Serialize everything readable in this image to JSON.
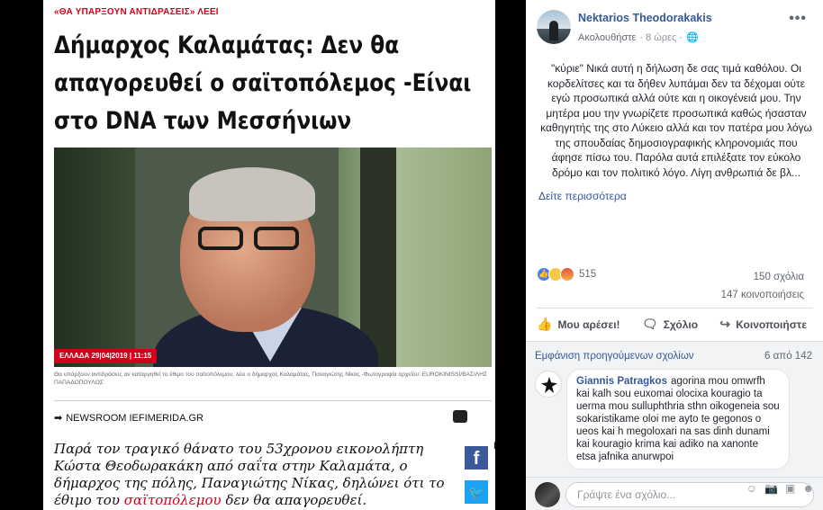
{
  "article": {
    "kicker": "«ΘΑ ΥΠΑΡΞΟΥΝ ΑΝΤΙΔΡΑΣΕΙΣ» ΛΕΕΙ",
    "headline_lines": [
      "Δήμαρχος Καλαμάτας: Δεν θα",
      "απαγορευθεί ο σαϊτοπόλεμος -Είναι",
      "στο DNA των Μεσσήνιων"
    ],
    "photo_tag_section": "ΕΛΛΑΔΑ 29|04|2019 | 11:15",
    "photo_tag_time": "",
    "caption": "Θα υπάρξουν αντιδράσεις αν καταργηθεί το έθιμο του σαϊτοπόλεμου, λέει ο δήμαρχος Καλαμάτας, Παναγιώτης Νίκας -Φωτογραφία αρχείου: EUROKINISSI/ΒΑΣΙΛΗΣ ΠΑΠΑΔΟΠΟΥΛΟΣ",
    "source": "NEWSROOM IEFIMERIDA.GR",
    "lede_before": "Παρά τον τραγικό θάνατο του 53χρονου εικονολήπτη Κώστα Θεοδωρακάκη από σαΐτα στην Καλαμάτα, ο δήμαρχος της πόλης, Παναγιώτης Νίκας, δηλώνει ότι το έθιμο του ",
    "lede_highlight": "σαϊτοπόλεμου",
    "lede_after": " δεν θα απαγορευθεί.",
    "share_fb": "f",
    "share_tw": "🐦"
  },
  "post": {
    "author": "Nektarios Theodorakakis",
    "follow_label": "Ακολουθήστε",
    "time": "· 8 ώρες ·",
    "privacy_icon": "globe-icon",
    "more": "•••",
    "text": "\"κύριε\" Νικά αυτή η δήλωση δε σας τιμά καθόλου. Οι κορδελίτσες και τα δήθεν λυπάμαι δεν τα δέχομαι ούτε εγώ προσωπικά αλλά ούτε και η οικογένειά μου. Την μητέρα μου την γνωρίζετε προσωπικά καθώς ήσασταν καθηγητής της στο Λύκειο αλλά και τον πατέρα μου λόγω της σπουδαίας δημοσιογραφικής κληρονομιάς που άφησε πίσω του. Παρόλα αυτά επιλέξατε τον εύκολο δρόμο και τον πολιτικό λόγο. Λίγη ανθρωπιά δε βλ...",
    "see_more": "Δείτε περισσότερα",
    "reaction_count": "515",
    "comments_count": "150 σχόλια",
    "shares_count": "147 κοινοποιήσεις",
    "actions": {
      "like": "Μου αρέσει!",
      "comment": "Σχόλιο",
      "share": "Κοινοποιήστε"
    }
  },
  "comments": {
    "previous_label": "Εμφάνιση προηγούμενων σχολίων",
    "page_count": "6 από 142",
    "items": [
      {
        "name": "Giannis Patragkos",
        "text": "agorina mou omwrfh\nkai kalh sou euxomai olocixa kouragio ta\nuerma mou sulluphthria sthn oikogeneia sou\nsokaristikame oloi me ayto te gegonos o\nueos kai h megoloxari na sas dinh dunami\nkai kouragio krima kai adiko na xanonte\netsa jafnika anurwpoi"
      }
    ],
    "composer_placeholder": "Γράψτε ένα σχόλιο..."
  },
  "colors": {
    "facebook_link": "#365899",
    "news_red": "#d0021b",
    "facebook_blue": "#3b5998",
    "twitter_blue": "#1da1f2"
  }
}
